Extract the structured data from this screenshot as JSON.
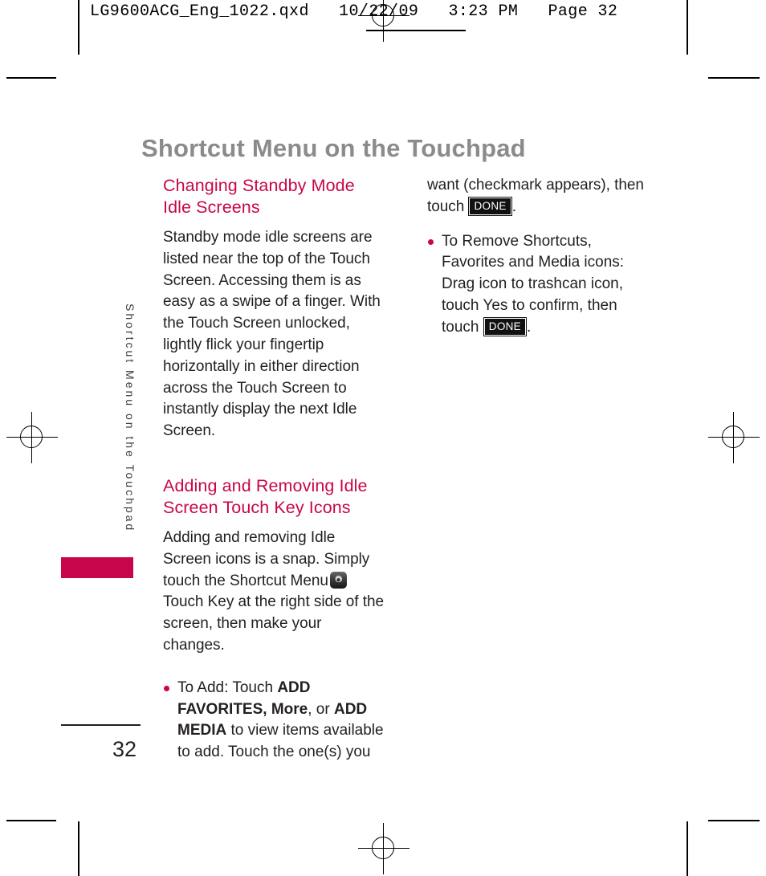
{
  "header": {
    "filename_line": "LG9600ACG_Eng_1022.qxd   10/22/09   3:23 PM   Page 32"
  },
  "page": {
    "title": "Shortcut Menu on the Touchpad",
    "side_tab_label": "Shortcut Menu on the Touchpad",
    "folio": "32",
    "accent_color": "#c8064b",
    "title_color": "#8b8b8b",
    "body_color": "#231f20"
  },
  "left_column": {
    "heading_1": "Changing Standby Mode Idle Screens",
    "paragraph_1": "Standby mode idle screens are listed near the top of the Touch Screen. Accessing them is as easy as a swipe of a finger. With the Touch Screen unlocked, lightly flick your fingertip horizontally in either direction across the Touch Screen to instantly display the next Idle Screen.",
    "heading_2": "Adding and Removing Idle Screen Touch Key Icons",
    "paragraph_2_part1": "Adding and removing Idle Screen icons is a snap. Simply touch the Shortcut Menu",
    "paragraph_2_part2": "Touch Key at the right side of the screen, then make your changes.",
    "bullet_1": {
      "lead": "To Add: Touch ",
      "bold_1": "ADD FAVORITES, More",
      "mid_1": ", or ",
      "bold_2": "ADD MEDIA",
      "tail": " to view items available to add. Touch the one(s) you"
    }
  },
  "right_column": {
    "continuation": {
      "lead": "want (checkmark appears), then touch ",
      "badge": "DONE",
      "tail": "."
    },
    "bullet_2": {
      "lead": "To Remove Shortcuts, Favorites and Media icons: Drag icon to trashcan icon, touch Yes to confirm, then touch ",
      "badge": "DONE",
      "tail": "."
    }
  },
  "icons": {
    "touch_key": "gear-icon"
  }
}
